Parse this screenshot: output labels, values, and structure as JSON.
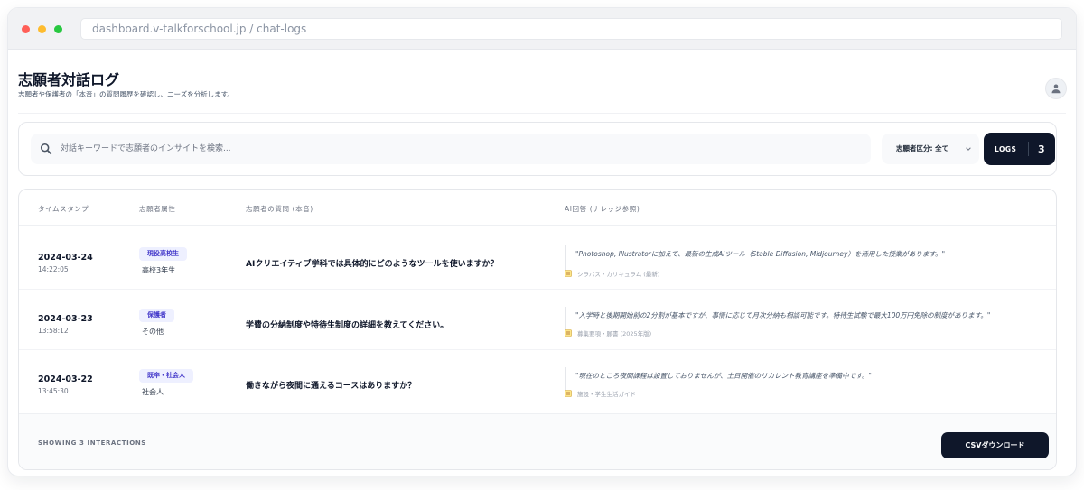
{
  "browser": {
    "url": "dashboard.v-talkforschool.jp / chat-logs"
  },
  "header": {
    "title": "志願者対話ログ",
    "subtitle": "志願者や保護者の「本音」の質問履歴を確認し、ニーズを分析します。",
    "avatar_icon": "user-icon"
  },
  "search": {
    "placeholder": "対話キーワードで志願者のインサイトを検索...",
    "value": "",
    "icon": "search-icon"
  },
  "filter": {
    "label": "志願者区分: 全て"
  },
  "logs": {
    "label": "LOGS",
    "count": "3"
  },
  "table": {
    "columns": [
      "タイムスタンプ",
      "志願者属性",
      "志願者の質問 (本音)",
      "AI回答 (ナレッジ参照)"
    ],
    "rows": [
      {
        "date": "2024-03-24",
        "time": "14:22:05",
        "badge": "現役高校生",
        "attribute": "高校3年生",
        "question": "AIクリエイティブ学科では具体的にどのようなツールを使いますか？",
        "answer": "\"Photoshop, Illustratorに加えて、最新の生成AIツール（Stable Diffusion, Midjourney）を活用した授業があります。\"",
        "source": "シラバス・カリキュラム (最新)"
      },
      {
        "date": "2024-03-23",
        "time": "13:58:12",
        "badge": "保護者",
        "attribute": "その他",
        "question": "学費の分納制度や特待生制度の詳細を教えてください。",
        "answer": "\"入学時と後期開始前の2分割が基本ですが、事情に応じて月次分納も相談可能です。特待生試験で最大100万円免除の制度があります。\"",
        "source": "募集要項・願書 (2025年版)"
      },
      {
        "date": "2024-03-22",
        "time": "13:45:30",
        "badge": "既卒・社会人",
        "attribute": "社会人",
        "question": "働きながら夜間に通えるコースはありますか？",
        "answer": "\"現在のところ夜間課程は設置しておりませんが、土日開催のリカレント教育講座を準備中です。\"",
        "source": "施設・学生生活ガイド"
      }
    ]
  },
  "footer": {
    "showing": "SHOWING 3 INTERACTIONS",
    "csv_button": "CSVダウンロード"
  }
}
